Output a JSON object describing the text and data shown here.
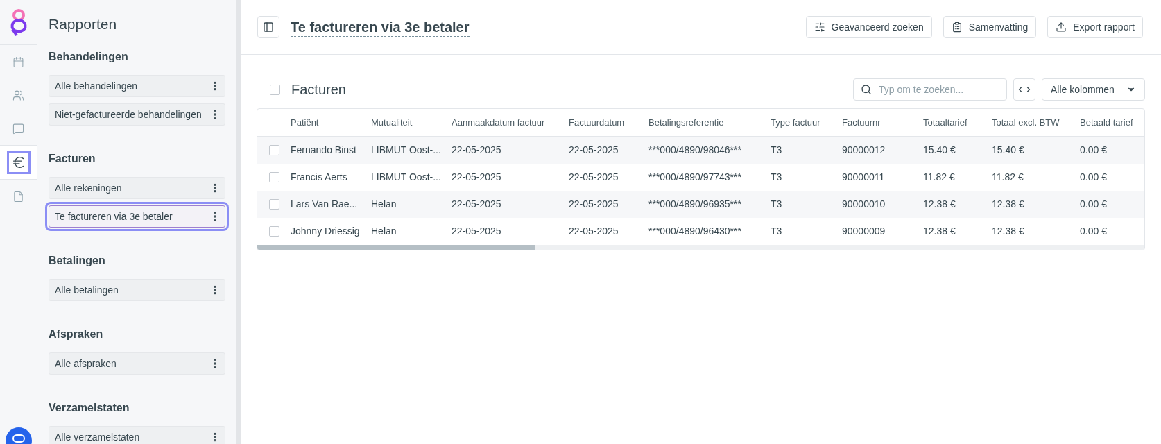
{
  "rail": {
    "items": [
      {
        "kind": "calendar",
        "selected": false
      },
      {
        "kind": "users",
        "selected": false
      },
      {
        "kind": "chat",
        "selected": false
      },
      {
        "kind": "euro",
        "selected": true
      },
      {
        "kind": "file",
        "selected": false
      }
    ]
  },
  "sidebar": {
    "title": "Rapporten",
    "sections": [
      {
        "title": "Behandelingen",
        "items": [
          {
            "label": "Alle behandelingen",
            "selected": false
          },
          {
            "label": "Niet-gefactureerde behandelingen",
            "selected": false
          }
        ]
      },
      {
        "title": "Facturen",
        "items": [
          {
            "label": "Alle rekeningen",
            "selected": false
          },
          {
            "label": "Te factureren via 3e betaler",
            "selected": true
          }
        ]
      },
      {
        "title": "Betalingen",
        "items": [
          {
            "label": "Alle betalingen",
            "selected": false
          }
        ]
      },
      {
        "title": "Afspraken",
        "items": [
          {
            "label": "Alle afspraken",
            "selected": false
          }
        ]
      },
      {
        "title": "Verzamelstaten",
        "items": [
          {
            "label": "Alle verzamelstaten",
            "selected": false
          }
        ]
      }
    ]
  },
  "header": {
    "title": "Te factureren via 3e betaler",
    "buttons": [
      {
        "kind": "sliders",
        "label": "Geavanceerd zoeken"
      },
      {
        "kind": "list",
        "label": "Samenvatting"
      },
      {
        "kind": "upload",
        "label": "Export rapport"
      }
    ]
  },
  "table": {
    "title": "Facturen",
    "select_all_checked": false,
    "search": {
      "placeholder": "Typ om te zoeken..."
    },
    "columns_dropdown": "Alle kolommen",
    "columns": [
      "Patiënt",
      "Mutualiteit",
      "Aanmaakdatum factuur",
      "Factuurdatum",
      "Betalingsreferentie",
      "Type factuur",
      "Factuurnr",
      "Totaaltarief",
      "Totaal excl. BTW",
      "Betaald tarief"
    ],
    "rows": [
      {
        "checked": false,
        "cells": [
          "Fernando Binst",
          "LIBMUT Oost-...",
          "22-05-2025",
          "22-05-2025",
          "***000/4890/98046***",
          "T3",
          "90000012",
          "15.40 €",
          "15.40 €",
          "0.00 €"
        ]
      },
      {
        "checked": false,
        "cells": [
          "Francis Aerts",
          "LIBMUT Oost-...",
          "22-05-2025",
          "22-05-2025",
          "***000/4890/97743***",
          "T3",
          "90000011",
          "11.82 €",
          "11.82 €",
          "0.00 €"
        ]
      },
      {
        "checked": false,
        "cells": [
          "Lars Van Rae...",
          "Helan",
          "22-05-2025",
          "22-05-2025",
          "***000/4890/96935***",
          "T3",
          "90000010",
          "12.38 €",
          "12.38 €",
          "0.00 €"
        ]
      },
      {
        "checked": false,
        "cells": [
          "Johnny Driessig",
          "Helan",
          "22-05-2025",
          "22-05-2025",
          "***000/4890/96430***",
          "T3",
          "90000009",
          "12.38 €",
          "12.38 €",
          "0.00 €"
        ]
      }
    ]
  }
}
